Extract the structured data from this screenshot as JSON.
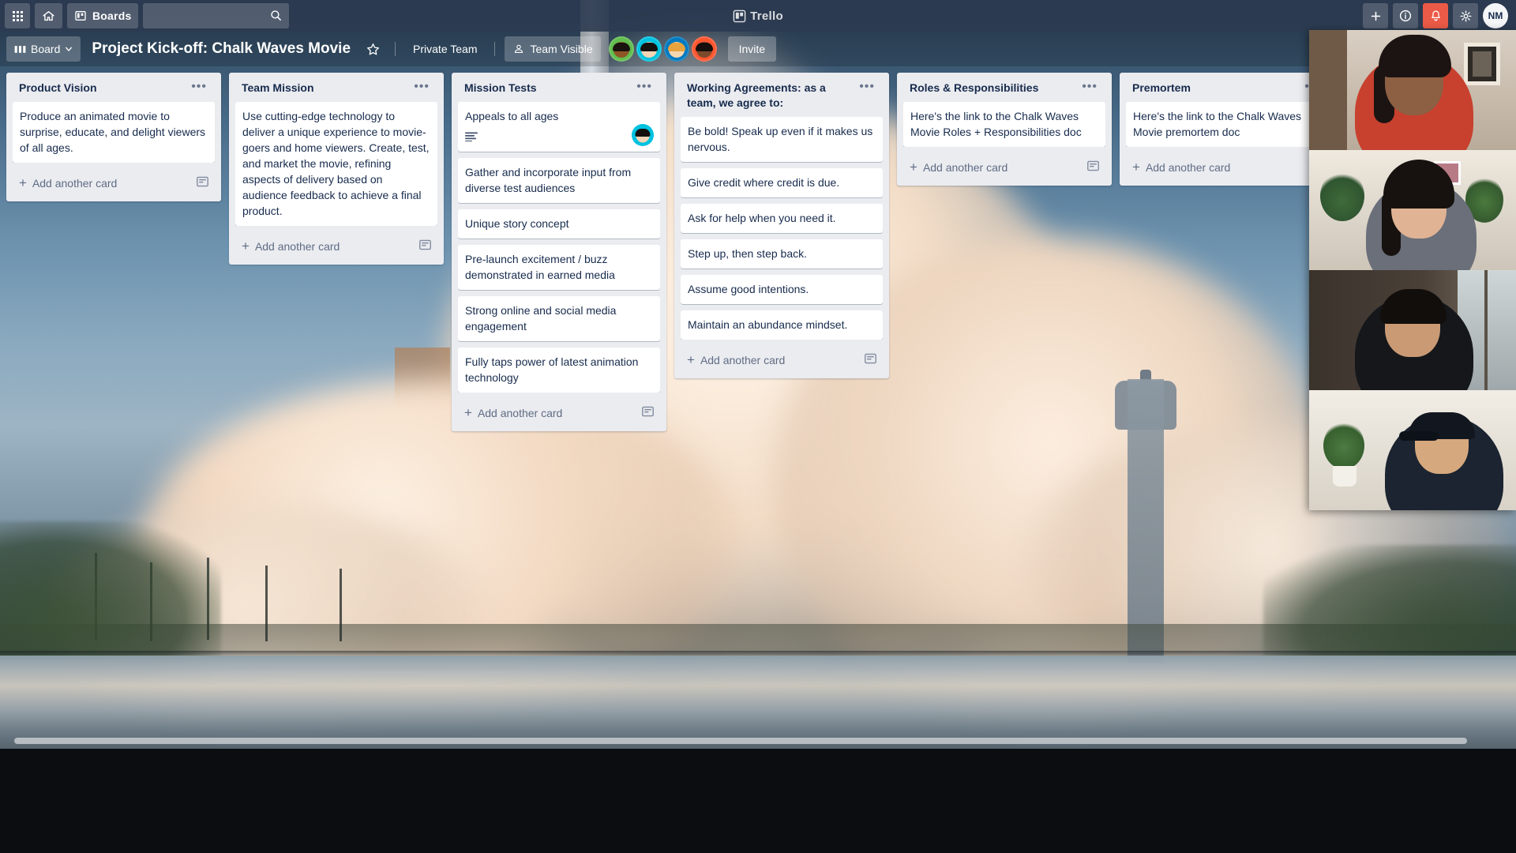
{
  "topbar": {
    "apps_icon": "grid-apps-icon",
    "home_icon": "home-icon",
    "boards_label": "Boards",
    "boards_icon": "board-icon",
    "search_placeholder": "",
    "search_value": "",
    "search_icon": "search-icon",
    "brand": "Trello",
    "brand_icon": "trello-logo-icon",
    "add_icon": "plus-icon",
    "info_icon": "info-circle-icon",
    "notifications_icon": "bell-icon",
    "settings_icon": "gear-icon",
    "user_initials": "NM",
    "notification_color": "#eb5a46"
  },
  "boardbar": {
    "view_label": "Board",
    "view_icon": "board-view-icon",
    "chevron_icon": "chevron-down-icon",
    "title": "Project Kick-off: Chalk Waves Movie",
    "star_icon": "star-icon",
    "team_label": "Private Team",
    "visibility_label": "Team Visible",
    "visibility_icon": "team-visible-icon",
    "invite_label": "Invite",
    "members": [
      {
        "name": "member-1",
        "ring": "#61bd4f",
        "skin": "#8d5524",
        "hair": "#1b1310"
      },
      {
        "name": "member-2",
        "ring": "#00c2e0",
        "skin": "#f3d5b5",
        "hair": "#14100e"
      },
      {
        "name": "member-3",
        "ring": "#0079bf",
        "skin": "#f6d7b0",
        "hair": "#e8a33d"
      },
      {
        "name": "member-4",
        "ring": "#ff5630",
        "skin": "#7a4a2b",
        "hair": "#150f0d"
      }
    ]
  },
  "lists": [
    {
      "title": "Product Vision",
      "menu_icon": "list-menu-icon",
      "add_card_label": "Add another card",
      "template_icon": "card-template-icon",
      "cards": [
        {
          "text": "Produce an animated movie to surprise, educate, and delight viewers of all ages.",
          "has_description": false,
          "avatar": null
        }
      ]
    },
    {
      "title": "Team Mission",
      "menu_icon": "list-menu-icon",
      "add_card_label": "Add another card",
      "template_icon": "card-template-icon",
      "cards": [
        {
          "text": "Use cutting-edge technology to deliver a unique experience to movie-goers and home viewers. Create, test, and market the movie, refining aspects of delivery based on audience feedback to achieve a final product.",
          "has_description": false,
          "avatar": null
        }
      ]
    },
    {
      "title": "Mission Tests",
      "menu_icon": "list-menu-icon",
      "add_card_label": "Add another card",
      "template_icon": "card-template-icon",
      "cards": [
        {
          "text": "Appeals to all ages",
          "has_description": true,
          "avatar": {
            "ring": "#00c2e0",
            "skin": "#f3d5b5",
            "hair": "#14100e"
          }
        },
        {
          "text": "Gather and incorporate input from diverse test audiences",
          "has_description": false,
          "avatar": null
        },
        {
          "text": "Unique story concept",
          "has_description": false,
          "avatar": null
        },
        {
          "text": "Pre-launch excitement / buzz demonstrated in earned media",
          "has_description": false,
          "avatar": null
        },
        {
          "text": "Strong online and social media engagement",
          "has_description": false,
          "avatar": null
        },
        {
          "text": "Fully taps power of latest animation technology",
          "has_description": false,
          "avatar": null
        }
      ]
    },
    {
      "title": "Working Agreements: as a team, we agree to:",
      "menu_icon": "list-menu-icon",
      "add_card_label": "Add another card",
      "template_icon": "card-template-icon",
      "cards": [
        {
          "text": "Be bold! Speak up even if it makes us nervous.",
          "has_description": false,
          "avatar": null
        },
        {
          "text": "Give credit where credit is due.",
          "has_description": false,
          "avatar": null
        },
        {
          "text": "Ask for help when you need it.",
          "has_description": false,
          "avatar": null
        },
        {
          "text": "Step up, then step back.",
          "has_description": false,
          "avatar": null
        },
        {
          "text": "Assume good intentions.",
          "has_description": false,
          "avatar": null
        },
        {
          "text": "Maintain an abundance mindset.",
          "has_description": false,
          "avatar": null
        }
      ]
    },
    {
      "title": "Roles & Responsibilities",
      "menu_icon": "list-menu-icon",
      "add_card_label": "Add another card",
      "template_icon": "card-template-icon",
      "cards": [
        {
          "text": "Here's the link to the Chalk Waves Movie Roles + Responsibilities doc",
          "has_description": false,
          "avatar": null
        }
      ]
    },
    {
      "title": "Premortem",
      "menu_icon": "list-menu-icon",
      "add_card_label": "Add another card",
      "template_icon": "card-template-icon",
      "cards": [
        {
          "text": "Here's the link to the Chalk Waves Movie premortem doc",
          "has_description": false,
          "avatar": null
        }
      ]
    }
  ],
  "video_call": {
    "participants": [
      {
        "name": "participant-1-tile"
      },
      {
        "name": "participant-2-tile"
      },
      {
        "name": "participant-3-tile"
      },
      {
        "name": "participant-4-tile"
      }
    ]
  },
  "scrollbar": {
    "name": "horizontal-scrollbar"
  }
}
